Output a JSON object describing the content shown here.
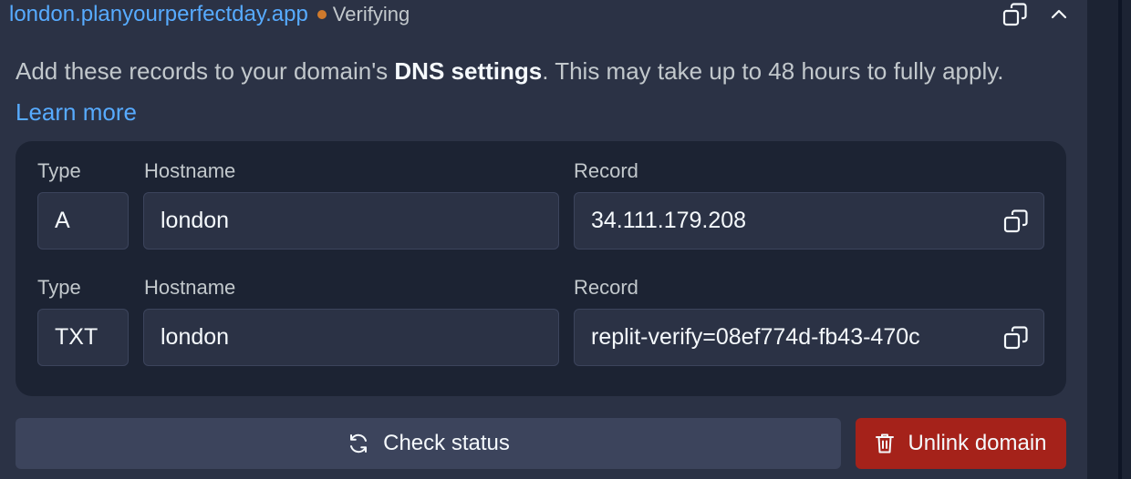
{
  "domain": {
    "name": "london.planyourperfectday.app",
    "status": "Verifying",
    "status_color": "#d07a2c"
  },
  "description": {
    "before": "Add these records to your domain's ",
    "bold": "DNS settings",
    "after": ". This may take up to 48 hours to fully apply. ",
    "link": "Learn more"
  },
  "records": [
    {
      "type_label": "Type",
      "hostname_label": "Hostname",
      "record_label": "Record",
      "type": "A",
      "hostname": "london",
      "record": "34.111.179.208"
    },
    {
      "type_label": "Type",
      "hostname_label": "Hostname",
      "record_label": "Record",
      "type": "TXT",
      "hostname": "london",
      "record": "replit-verify=08ef774d-fb43-470c"
    }
  ],
  "actions": {
    "check_status": "Check status",
    "unlink_domain": "Unlink domain"
  },
  "colors": {
    "link": "#57abff",
    "danger": "#a5221a"
  },
  "icons": {
    "copy": "copy-icon",
    "collapse": "chevron-up-icon",
    "refresh": "refresh-icon",
    "trash": "trash-icon"
  }
}
